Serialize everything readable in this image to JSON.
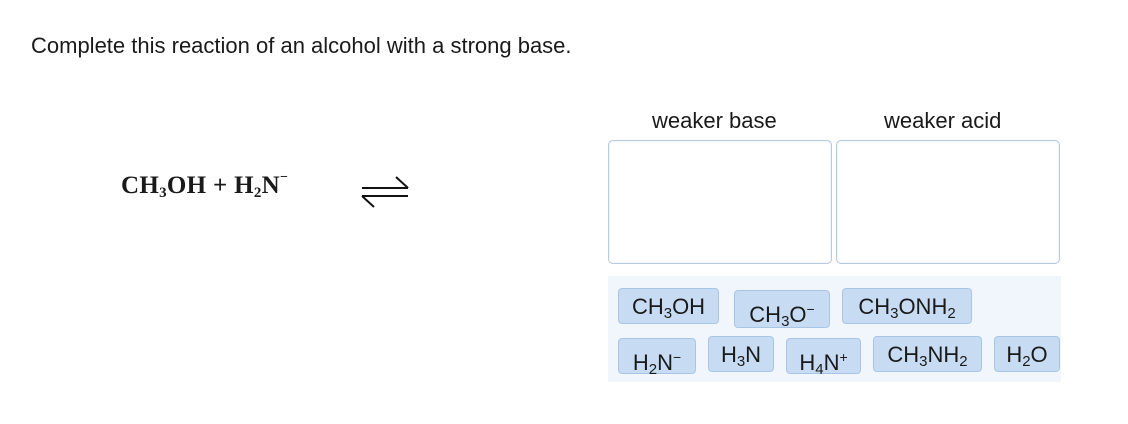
{
  "prompt": "Complete this reaction of an alcohol with a strong base.",
  "equation": {
    "r1_a": "CH",
    "r1_sub": "3",
    "r1_b": "OH",
    "plus": "+",
    "r2_a": "H",
    "r2_sub": "2",
    "r2_b": "N",
    "r2_sup": "−"
  },
  "columns": {
    "left_label": "weaker base",
    "right_label": "weaker acid"
  },
  "chips": {
    "ch3oh": {
      "a": "CH",
      "s": "3",
      "b": "OH"
    },
    "ch3o": {
      "a": "CH",
      "s": "3",
      "b": "O",
      "sup": "−"
    },
    "ch3onh2": {
      "a": "CH",
      "s": "3",
      "b": "ONH",
      "s2": "2"
    },
    "h2n": {
      "a": "H",
      "s": "2",
      "b": "N",
      "sup": "−"
    },
    "h3n": {
      "a": "H",
      "s": "3",
      "b": "N"
    },
    "h4n": {
      "a": "H",
      "s": "4",
      "b": "N",
      "sup": "+"
    },
    "ch3nh2": {
      "a": "CH",
      "s": "3",
      "b": "NH",
      "s2": "2"
    },
    "h2o": {
      "a": "H",
      "s": "2",
      "b": "O"
    }
  },
  "icons": {
    "equilibrium": "equilibrium-arrow-icon"
  },
  "colors": {
    "chip_fill": "#c7dcf3",
    "chip_border": "#a9c5e6",
    "box_border": "#b8c8dd",
    "palette_bg": "#f1f6fc"
  }
}
